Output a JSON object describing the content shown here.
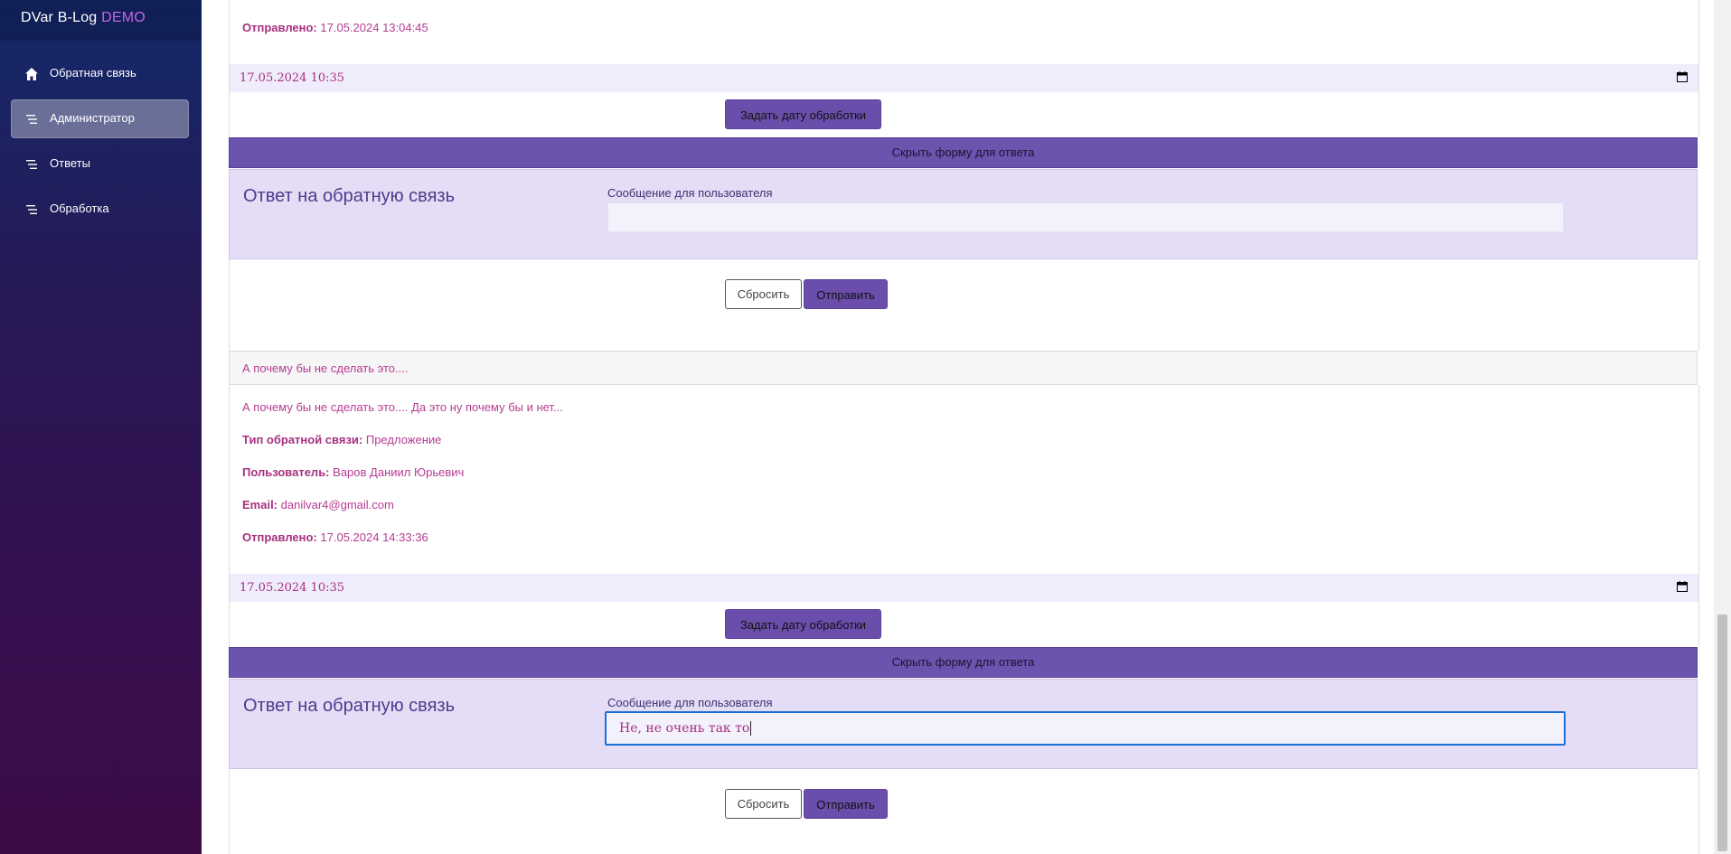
{
  "brand": {
    "name": "DVar B-Log",
    "tag": "DEMO"
  },
  "sidebar": {
    "items": [
      {
        "label": "Обратная связь",
        "icon": "home-icon",
        "active": false
      },
      {
        "label": "Администратор",
        "icon": "list-icon",
        "active": true
      },
      {
        "label": "Ответы",
        "icon": "list-icon",
        "active": false
      },
      {
        "label": "Обработка",
        "icon": "list-icon",
        "active": false
      }
    ]
  },
  "colors": {
    "accent": "#6b54ae",
    "text_pink": "#a7307f",
    "panel": "#e5dcf5"
  },
  "entry1": {
    "sent_label": "Отправлено:",
    "sent_value": "17.05.2024 13:04:45",
    "date_value": "17.05.2024 10:35",
    "set_date_button": "Задать дату обработки",
    "toggle_form_button": "Скрыть форму для ответа",
    "answer_title": "Ответ на обратную связь",
    "answer_label": "Сообщение для пользователя",
    "answer_value": "",
    "reset_button": "Сбросить",
    "send_button": "Отправить"
  },
  "entry2": {
    "header": "А почему бы не сделать это....",
    "message": "А почему бы не сделать это.... Да это ну почему бы и нет...",
    "type_label": "Тип обратной связи:",
    "type_value": "Предложение",
    "user_label": "Пользователь:",
    "user_value": "Варов Даниил Юрьевич",
    "email_label": "Email:",
    "email_value": "danilvar4@gmail.com",
    "sent_label": "Отправлено:",
    "sent_value": "17.05.2024 14:33:36",
    "date_value": "17.05.2024 10:35",
    "set_date_button": "Задать дату обработки",
    "toggle_form_button": "Скрыть форму для ответа",
    "answer_title": "Ответ на обратную связь",
    "answer_label": "Сообщение для пользователя",
    "answer_value": "Не, не очень так то",
    "reset_button": "Сбросить",
    "send_button": "Отправить"
  }
}
